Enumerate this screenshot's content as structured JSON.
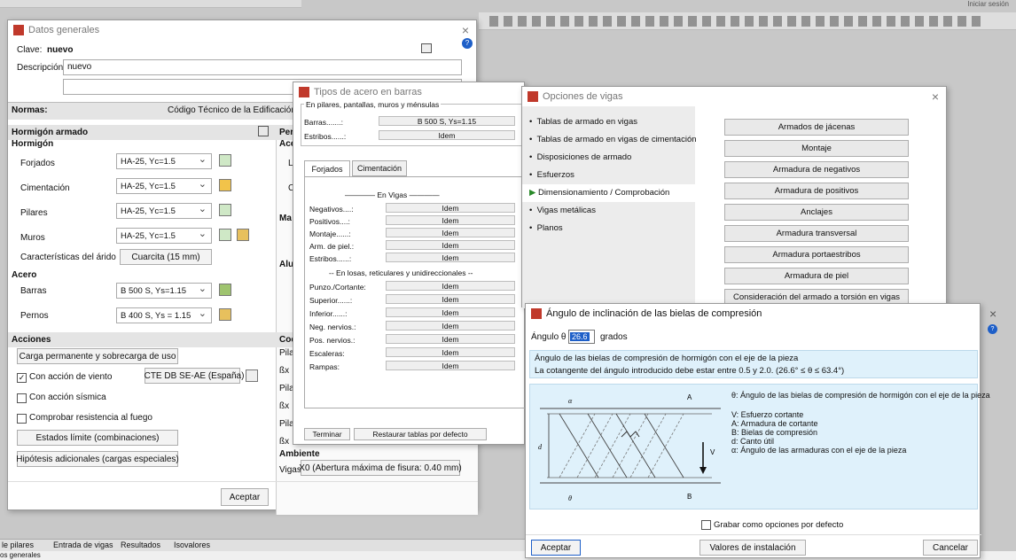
{
  "app": {
    "login": "Iniciar sesión",
    "status_bottom": "os generales",
    "tabs": [
      "le pilares",
      "Entrada de vigas",
      "Resultados",
      "Isovalores"
    ]
  },
  "datos_generales": {
    "title": "Datos generales",
    "clave_label": "Clave:",
    "clave_value": "nuevo",
    "descripcion_label": "Descripción:",
    "descripcion_value": "nuevo",
    "normas_label": "Normas:",
    "normas_value": "Código Técnico de la Edificación - C",
    "hormigon_armado": "Hormigón armado",
    "hormigon": "Hormigón",
    "rows": [
      {
        "label": "Forjados",
        "value": "HA-25, Yc=1.5"
      },
      {
        "label": "Cimentación",
        "value": "HA-25, Yc=1.5"
      },
      {
        "label": "Pilares",
        "value": "HA-25, Yc=1.5"
      },
      {
        "label": "Muros",
        "value": "HA-25, Yc=1.5"
      }
    ],
    "arido_label": "Características del árido",
    "arido_value": "Cuarcita (15 mm)",
    "acero": "Acero",
    "barras_label": "Barras",
    "barras_value": "B 500 S, Ys=1.15",
    "pernos_label": "Pernos",
    "pernos_value": "B 400 S, Ys = 1.15",
    "acciones": "Acciones",
    "carga_btn": "Carga permanente y sobrecarga de uso",
    "viento_label": "Con acción de viento",
    "viento_norma": "CTE DB SE-AE (España)",
    "sismica_label": "Con acción sísmica",
    "fuego_label": "Comprobar resistencia al fuego",
    "estados_btn": "Estados límite (combinaciones)",
    "hipotesis_btn": "Hipótesis adicionales (cargas especiales)",
    "aceptar": "Aceptar",
    "col2_per": "Per",
    "col2_ace": "Ace",
    "col2_l": "L",
    "col2_c": "C",
    "col2_ma": "Ma",
    "col2_alu": "Alu",
    "coe": "Coe",
    "pilar": "Pilar",
    "bx": "ßx",
    "ambiente": "Ambiente",
    "vigas_label": "Vigas",
    "vigas_value": "X0 (Abertura máxima de fisura: 0.40 mm)"
  },
  "tipos_acero": {
    "title": "Tipos de acero en barras",
    "group": "En pilares, pantallas, muros y ménsulas",
    "barras_label": "Barras.......:",
    "barras_value": "B 500 S, Ys=1.15",
    "estribos_label": "Estribos......:",
    "estribos_value": "Idem",
    "tab_forjados": "Forjados",
    "tab_cimentacion": "Cimentación",
    "en_vigas": "En Vigas",
    "vigas_rows": [
      "Negativos....:",
      "Positivos....:",
      "Montaje......:",
      "Arm. de piel.:",
      "Estribos......:"
    ],
    "en_losas": "-- En losas, reticulares y unidireccionales --",
    "losas_rows": [
      "Punzo./Cortante:",
      "Superior......:",
      "Inferior......:",
      "Neg. nervios.:",
      "Pos. nervios.:",
      "Escaleras:",
      "Rampas:"
    ],
    "idem": "Idem",
    "terminar": "Terminar",
    "restaurar": "Restaurar tablas por defecto"
  },
  "opciones_vigas": {
    "title": "Opciones de vigas",
    "items": [
      "Tablas de armado en vigas",
      "Tablas de armado en vigas de cimentación",
      "Disposiciones de armado",
      "Esfuerzos",
      "Dimensionamiento / Comprobación",
      "Vigas metálicas",
      "Planos"
    ],
    "buttons": [
      "Armados de jácenas",
      "Montaje",
      "Armadura de negativos",
      "Armadura de positivos",
      "Anclajes",
      "Armadura transversal",
      "Armadura portaestribos",
      "Armadura de piel",
      "Consideración del armado a torsión en vigas"
    ]
  },
  "angulo": {
    "title": "Ángulo de inclinación de las bielas de compresión",
    "angulo_label": "Ángulo θ",
    "angulo_value": "26.6",
    "grados": "grados",
    "info1": "Ángulo de las bielas de compresión de hormigón con el eje de la pieza",
    "info2": "La cotangente del ángulo introducido debe estar entre 0.5 y 2.0. (26.6° ≤ θ ≤ 63.4°)",
    "legend_theta": "θ: Ángulo de las bielas de compresión de hormigón con el eje de la pieza",
    "legend": [
      "V: Esfuerzo cortante",
      "A: Armadura de cortante",
      "B: Bielas de compresión",
      "d: Canto útil",
      "α: Ángulo de las armaduras con el eje de la pieza"
    ],
    "dlabels": {
      "a": "A",
      "b": "B",
      "d": "d",
      "v": "V",
      "alpha": "α",
      "theta": "θ"
    },
    "grabar": "Grabar como opciones por defecto",
    "aceptar": "Aceptar",
    "valores": "Valores de instalación",
    "cancelar": "Cancelar"
  },
  "colors": {
    "accent": "#c0392b",
    "info_bg": "#dff1fb",
    "select_bg": "#e8e8e8"
  }
}
